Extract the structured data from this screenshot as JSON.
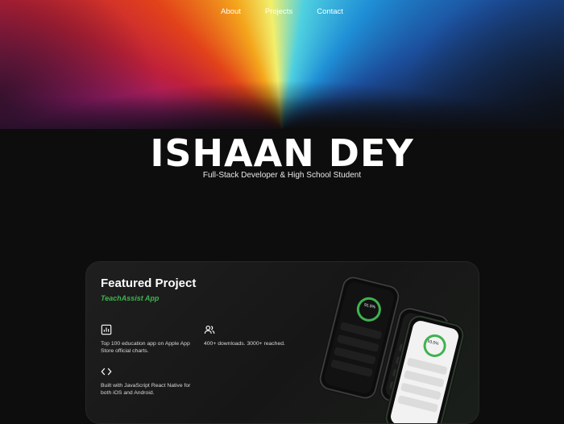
{
  "nav": {
    "about": "About",
    "projects": "Projects",
    "contact": "Contact"
  },
  "hero": {
    "name": "ISHAAN DEY",
    "tagline": "Full-Stack Developer & High School Student"
  },
  "featured": {
    "heading": "Featured Project",
    "project": "TeachAssist App",
    "items": [
      {
        "icon": "bar-chart-icon",
        "text": "Top 100 education app on Apple App Store official charts."
      },
      {
        "icon": "users-icon",
        "text": "400+ downloads. 3000+ reached."
      },
      {
        "icon": "code-icon",
        "text": "Built with JavaScript React Native for both iOS and Android."
      }
    ]
  },
  "phone_screen": {
    "score_front": "91.5%",
    "score_back": "93.5%"
  },
  "colors": {
    "accent": "#3fb24f",
    "background": "#0d0d0d",
    "card": "#1a1a1a"
  }
}
